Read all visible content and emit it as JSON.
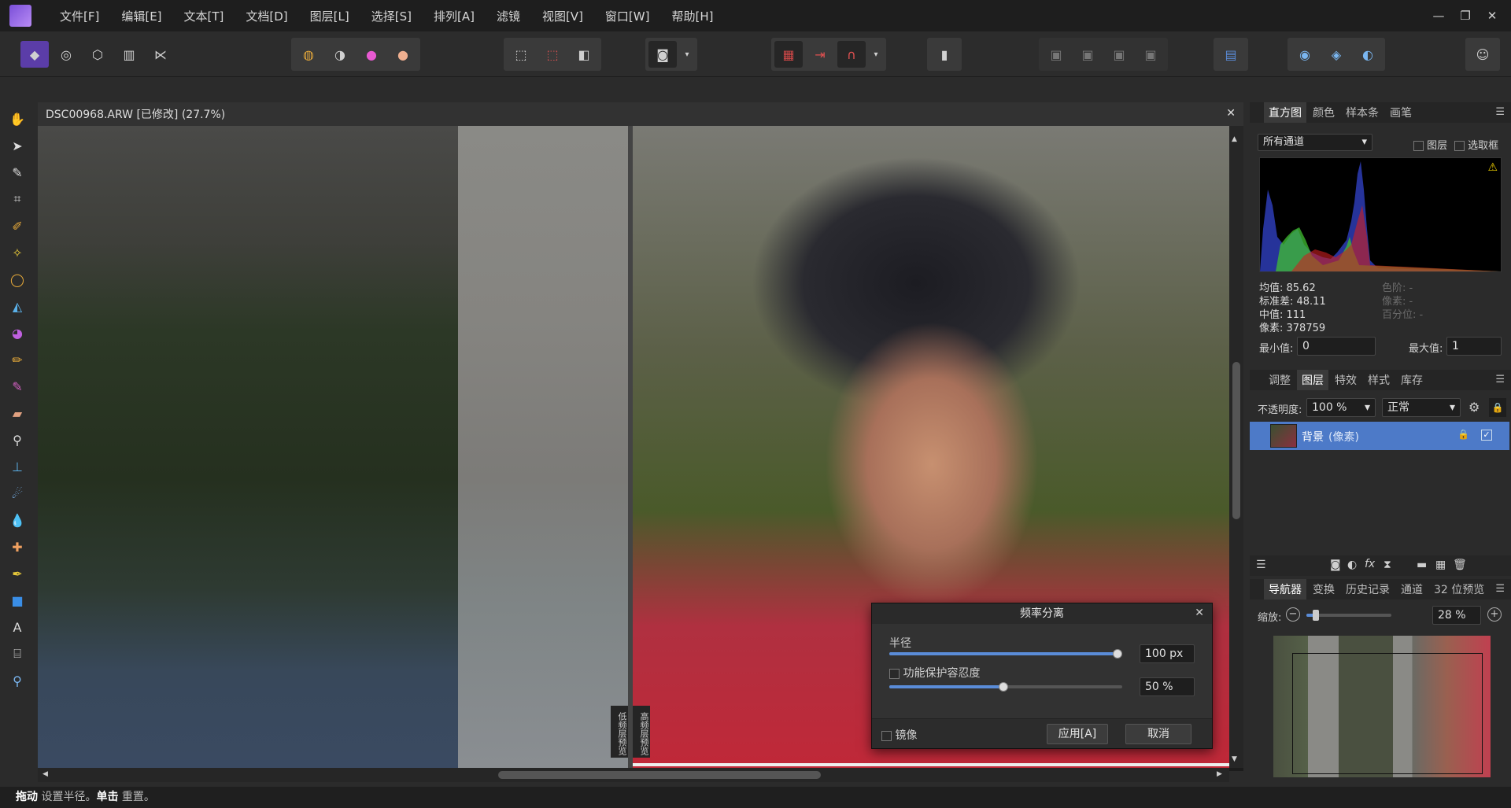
{
  "menubar": {
    "items": [
      "文件[F]",
      "编辑[E]",
      "文本[T]",
      "文档[D]",
      "图层[L]",
      "选择[S]",
      "排列[A]",
      "滤镜",
      "视图[V]",
      "窗口[W]",
      "帮助[H]"
    ],
    "minimize": "—",
    "restore": "❐",
    "close": "✕"
  },
  "document": {
    "tab_title": "DSC00968.ARW [已修改] (27.7%)",
    "close": "✕",
    "label_left": "高频层预览",
    "label_right": "低频层预览"
  },
  "tools": [
    "hand-tool",
    "move-tool",
    "color-picker",
    "crop-tool",
    "selection-brush",
    "flood-select",
    "freehand-selection",
    "flood-fill",
    "gradient",
    "paint-brush",
    "color-replacement",
    "erase-brush",
    "dodge-tool",
    "clone-brush",
    "smudge-brush",
    "blur-brush",
    "healing-brush",
    "pen-tool",
    "shape-tool",
    "text-tool",
    "mesh-warp",
    "zoom-tool"
  ],
  "histogram": {
    "tabs": [
      "直方图",
      "颜色",
      "样本条",
      "画笔"
    ],
    "channel": "所有通道",
    "layer_label": "图层",
    "selection_label": "选取框",
    "stats": {
      "mean": "均值: 85.62",
      "stddev": "标准差: 48.11",
      "median": "中值: 111",
      "pixels": "像素: 378759",
      "level": "色阶: -",
      "pixel2": "像素: -",
      "percentile": "百分位: -"
    },
    "min_label": "最小值:",
    "min_value": "0",
    "max_label": "最大值:",
    "max_value": "1",
    "warning_icon": "⚠"
  },
  "layers": {
    "tabs": [
      "调整",
      "图层",
      "特效",
      "样式",
      "库存"
    ],
    "opacity_label": "不透明度:",
    "opacity_value": "100 %",
    "blend_mode": "正常",
    "layer_name": "背景",
    "layer_type": "(像素)"
  },
  "navigator": {
    "tabs": [
      "导航器",
      "变换",
      "历史记录",
      "通道",
      "32 位预览"
    ],
    "zoom_label": "缩放:",
    "zoom_value": "28 %",
    "minus": "−",
    "plus": "+"
  },
  "dialog": {
    "title": "频率分离",
    "close": "✕",
    "radius_label": "半径",
    "radius_value": "100 px",
    "radius_fraction": 1.0,
    "protect_label": "功能保护容忍度",
    "protect_value": "50 %",
    "protect_fraction": 0.5,
    "mirror_label": "镜像",
    "apply_label": "应用[A]",
    "cancel_label": "取消"
  },
  "status": {
    "drag": "拖动",
    "drag_desc": " 设置半径。",
    "click": "单击",
    "click_desc": " 重置。"
  },
  "colors": {
    "accent": "#5a8cd8",
    "brand": "#7a4fd8"
  }
}
